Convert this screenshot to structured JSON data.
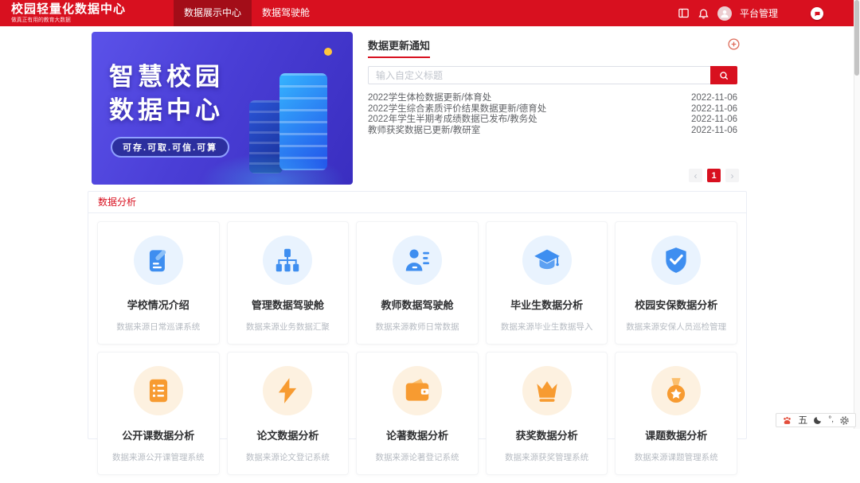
{
  "colors": {
    "accent_red": "#d8101f",
    "nav_active_red": "#a30d18",
    "icon_blue": "#3e8ef0",
    "icon_orange": "#f79b31",
    "banner_purple": "#4a3ed6"
  },
  "header": {
    "logo_title": "校园轻量化数据中心",
    "logo_subtitle": "做真正有用的教育大数据",
    "nav": [
      {
        "label": "数据展示中心",
        "active": true
      },
      {
        "label": "数据驾驶舱",
        "active": false
      }
    ],
    "icons": [
      "screen-switch-icon",
      "bell-icon",
      "avatar"
    ],
    "user_label": "平台管理"
  },
  "banner": {
    "title_line1": "智慧校园",
    "title_line2": "数据中心",
    "tagline": "可存.可取.可信.可算"
  },
  "notice_panel": {
    "title": "数据更新通知",
    "add_icon": "plus-circle-icon",
    "search_placeholder": "输入自定义标题",
    "search_icon": "search-icon",
    "items": [
      {
        "text": "2022学生体检数据更新/体育处",
        "date": "2022-11-06"
      },
      {
        "text": "2022学生综合素质评价结果数据更新/德育处",
        "date": "2022-11-06"
      },
      {
        "text": "2022年学生半期考成绩数据已发布/教务处",
        "date": "2022-11-06"
      },
      {
        "text": "教师获奖数据已更新/教研室",
        "date": "2022-11-06"
      }
    ],
    "pagination": {
      "prev": "‹",
      "current": "1",
      "next": "›"
    }
  },
  "analysis": {
    "title": "数据分析",
    "cards": [
      {
        "title": "学校情况介绍",
        "subtitle": "数据来源日常巡课系统",
        "icon": "edit-note-icon",
        "theme": "blue"
      },
      {
        "title": "管理数据驾驶舱",
        "subtitle": "数据来源业务数据汇聚",
        "icon": "org-chart-icon",
        "theme": "blue"
      },
      {
        "title": "教师数据驾驶舱",
        "subtitle": "数据来源教师日常数据",
        "icon": "person-list-icon",
        "theme": "blue"
      },
      {
        "title": "毕业生数据分析",
        "subtitle": "数据来源毕业生数据导入",
        "icon": "graduation-cap-icon",
        "theme": "blue"
      },
      {
        "title": "校园安保数据分析",
        "subtitle": "数据来源安保人员巡检管理",
        "icon": "shield-check-icon",
        "theme": "blue"
      },
      {
        "title": "公开课数据分析",
        "subtitle": "数据来源公开课管理系统",
        "icon": "list-doc-icon",
        "theme": "orange"
      },
      {
        "title": "论文数据分析",
        "subtitle": "数据来源论文登记系统",
        "icon": "lightning-icon",
        "theme": "orange"
      },
      {
        "title": "论著数据分析",
        "subtitle": "数据来源论著登记系统",
        "icon": "wallet-icon",
        "theme": "orange"
      },
      {
        "title": "获奖数据分析",
        "subtitle": "数据来源获奖管理系统",
        "icon": "crown-icon",
        "theme": "orange"
      },
      {
        "title": "课题数据分析",
        "subtitle": "数据来源课题管理系统",
        "icon": "medal-icon",
        "theme": "orange"
      }
    ]
  },
  "ime_bar": {
    "wubi_label": "五",
    "punct_label": "°,",
    "icons": [
      "paw-icon",
      "moon-icon",
      "gear-icon"
    ]
  }
}
